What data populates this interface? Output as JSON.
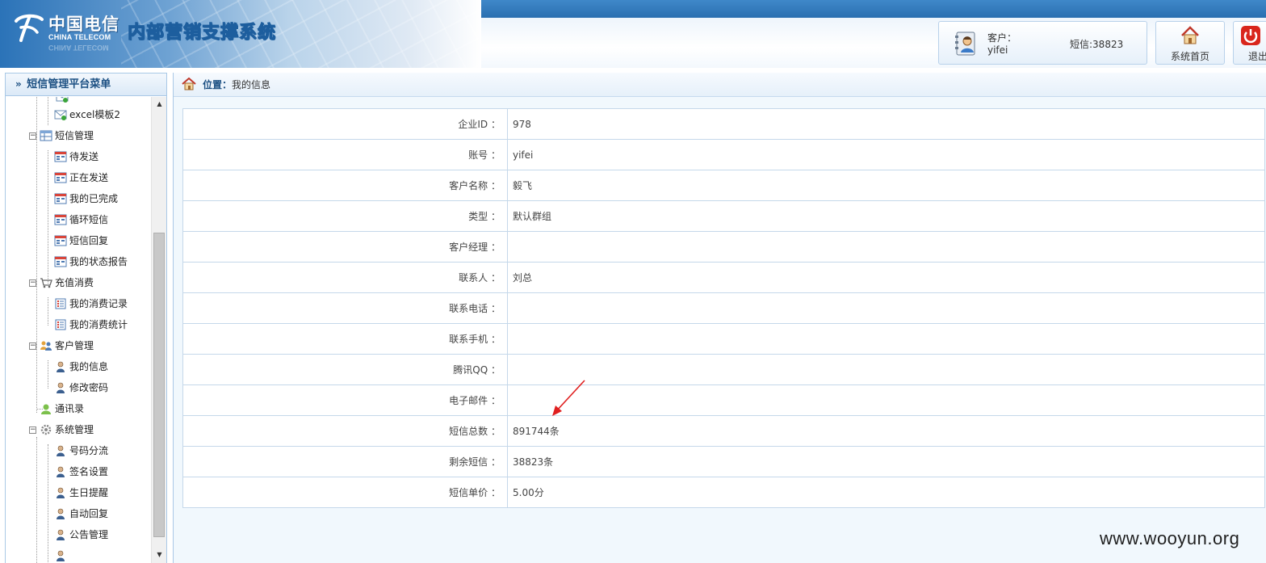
{
  "header": {
    "logo_cn": "中国电信",
    "logo_en": "CHINA TELECOM",
    "system_title": "内部营销支撑系统",
    "user_label": "客户：",
    "user_name": "yifei",
    "sms_balance": "短信:38823",
    "home_label": "系统首页",
    "logout_label": "退出"
  },
  "sidebar": {
    "title": "短信管理平台菜单",
    "items": [
      {
        "label": "excel模板2",
        "level": 2,
        "icon": "envelope-icon"
      },
      {
        "label": "短信管理",
        "level": 1,
        "icon": "table-icon"
      },
      {
        "label": "待发送",
        "level": 2,
        "icon": "form-icon"
      },
      {
        "label": "正在发送",
        "level": 2,
        "icon": "form-icon"
      },
      {
        "label": "我的已完成",
        "level": 2,
        "icon": "form-icon"
      },
      {
        "label": "循环短信",
        "level": 2,
        "icon": "form-icon"
      },
      {
        "label": "短信回复",
        "level": 2,
        "icon": "form-icon"
      },
      {
        "label": "我的状态报告",
        "level": 2,
        "icon": "form-icon"
      },
      {
        "label": "充值消费",
        "level": 1,
        "icon": "cart-icon"
      },
      {
        "label": "我的消费记录",
        "level": 2,
        "icon": "checklist-icon"
      },
      {
        "label": "我的消费统计",
        "level": 2,
        "icon": "checklist-icon"
      },
      {
        "label": "客户管理",
        "level": 1,
        "icon": "users-icon"
      },
      {
        "label": "我的信息",
        "level": 2,
        "icon": "user-icon"
      },
      {
        "label": "修改密码",
        "level": 2,
        "icon": "user-icon"
      },
      {
        "label": "通讯录",
        "level": 1,
        "icon": "contact-icon"
      },
      {
        "label": "系统管理",
        "level": 1,
        "icon": "gear-icon"
      },
      {
        "label": "号码分流",
        "level": 2,
        "icon": "user-icon"
      },
      {
        "label": "签名设置",
        "level": 2,
        "icon": "user-icon"
      },
      {
        "label": "生日提醒",
        "level": 2,
        "icon": "user-icon"
      },
      {
        "label": "自动回复",
        "level": 2,
        "icon": "user-icon"
      },
      {
        "label": "公告管理",
        "level": 2,
        "icon": "user-icon"
      }
    ]
  },
  "breadcrumb": {
    "label": "位置：",
    "current": "我的信息"
  },
  "info": {
    "rows": [
      {
        "key": "企业ID ：",
        "value": "978"
      },
      {
        "key": "账号 ：",
        "value": "yifei"
      },
      {
        "key": "客户名称 ：",
        "value": "毅飞"
      },
      {
        "key": "类型 ：",
        "value": "默认群组"
      },
      {
        "key": "客户经理 ：",
        "value": ""
      },
      {
        "key": "联系人 ：",
        "value": "刘总"
      },
      {
        "key": "联系电话 ：",
        "value": ""
      },
      {
        "key": "联系手机 ：",
        "value": ""
      },
      {
        "key": "腾讯QQ ：",
        "value": ""
      },
      {
        "key": "电子邮件 ：",
        "value": ""
      },
      {
        "key": "短信总数 ：",
        "value": "891744条"
      },
      {
        "key": "剩余短信 ：",
        "value": "38823条"
      },
      {
        "key": "短信单价 ：",
        "value": "5.00分"
      }
    ]
  },
  "watermark": "www.wooyun.org",
  "colors": {
    "brand_blue": "#2a6fb0",
    "border_blue": "#a9c8e6",
    "arrow_red": "#e02020"
  }
}
